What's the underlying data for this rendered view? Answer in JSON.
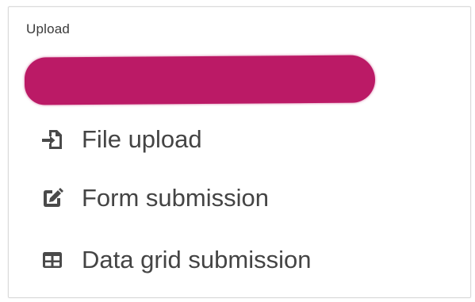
{
  "panel": {
    "header": "Upload"
  },
  "colors": {
    "redaction": "#bb1a66",
    "icon": "#4a4a4a",
    "text": "#444444"
  },
  "menu": {
    "items": [
      {
        "label": "File upload",
        "icon": "file-import-icon"
      },
      {
        "label": "Form submission",
        "icon": "edit-icon"
      },
      {
        "label": "Data grid submission",
        "icon": "table-icon"
      }
    ]
  }
}
